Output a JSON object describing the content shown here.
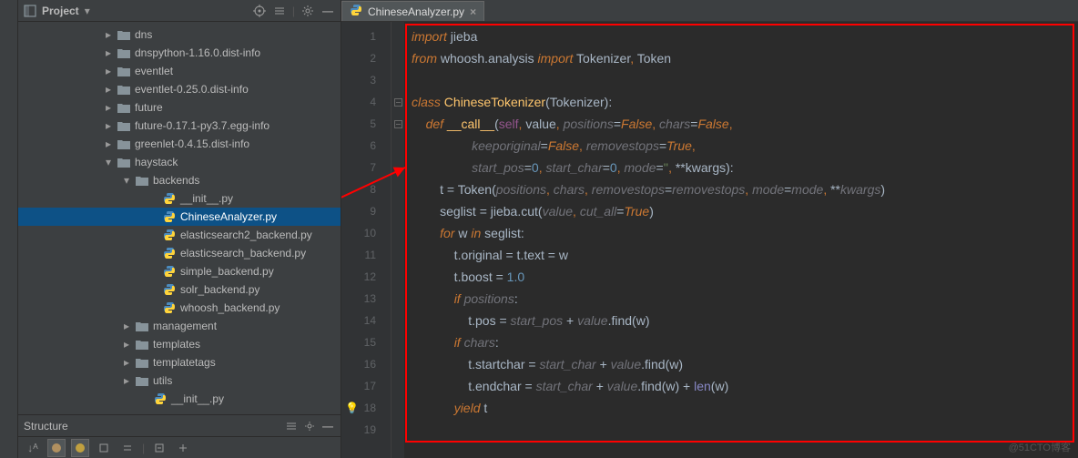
{
  "sidebar": {
    "title": "Project",
    "structure_title": "Structure",
    "tree": [
      {
        "indent": 80,
        "expand": "right",
        "icon": "folder",
        "label": "dns"
      },
      {
        "indent": 80,
        "expand": "right",
        "icon": "folder",
        "label": "dnspython-1.16.0.dist-info"
      },
      {
        "indent": 80,
        "expand": "right",
        "icon": "folder",
        "label": "eventlet"
      },
      {
        "indent": 80,
        "expand": "right",
        "icon": "folder",
        "label": "eventlet-0.25.0.dist-info"
      },
      {
        "indent": 80,
        "expand": "right",
        "icon": "folder",
        "label": "future"
      },
      {
        "indent": 80,
        "expand": "right",
        "icon": "folder",
        "label": "future-0.17.1-py3.7.egg-info"
      },
      {
        "indent": 80,
        "expand": "right",
        "icon": "folder",
        "label": "greenlet-0.4.15.dist-info"
      },
      {
        "indent": 80,
        "expand": "down",
        "icon": "folder",
        "label": "haystack"
      },
      {
        "indent": 100,
        "expand": "down",
        "icon": "folder",
        "label": "backends"
      },
      {
        "indent": 130,
        "expand": "none",
        "icon": "py",
        "label": "__init__.py"
      },
      {
        "indent": 130,
        "expand": "none",
        "icon": "py",
        "label": "ChineseAnalyzer.py",
        "selected": true
      },
      {
        "indent": 130,
        "expand": "none",
        "icon": "py",
        "label": "elasticsearch2_backend.py"
      },
      {
        "indent": 130,
        "expand": "none",
        "icon": "py",
        "label": "elasticsearch_backend.py"
      },
      {
        "indent": 130,
        "expand": "none",
        "icon": "py",
        "label": "simple_backend.py"
      },
      {
        "indent": 130,
        "expand": "none",
        "icon": "py",
        "label": "solr_backend.py"
      },
      {
        "indent": 130,
        "expand": "none",
        "icon": "py",
        "label": "whoosh_backend.py"
      },
      {
        "indent": 100,
        "expand": "right",
        "icon": "folder",
        "label": "management"
      },
      {
        "indent": 100,
        "expand": "right",
        "icon": "folder",
        "label": "templates"
      },
      {
        "indent": 100,
        "expand": "right",
        "icon": "folder",
        "label": "templatetags"
      },
      {
        "indent": 100,
        "expand": "right",
        "icon": "folder",
        "label": "utils"
      },
      {
        "indent": 120,
        "expand": "none",
        "icon": "py",
        "label": "__init__.py"
      }
    ]
  },
  "editor": {
    "tab": "ChineseAnalyzer.py",
    "watermark": "@51CTO博客",
    "lines": [
      {
        "n": 1,
        "fold": "",
        "html": "<span class='kw'>import</span> jieba"
      },
      {
        "n": 2,
        "fold": "",
        "html": "<span class='kw'>from</span> whoosh.analysis <span class='kw'>import</span> Tokenizer<span class='kw2'>,</span> Token"
      },
      {
        "n": 3,
        "fold": "",
        "html": ""
      },
      {
        "n": 4,
        "fold": "-",
        "html": "<span class='kw'>class</span> <span class='cls'>ChineseTokenizer</span>(Tokenizer):"
      },
      {
        "n": 5,
        "fold": "-",
        "html": "    <span class='kw'>def</span> <span class='fn'>__call__</span>(<span class='self'>self</span><span class='kw2'>,</span> <span class='paramv'>value</span><span class='kw2'>,</span> <span class='param'>positions</span>=<span class='bool'>False</span><span class='kw2'>,</span> <span class='param'>chars</span>=<span class='bool'>False</span><span class='kw2'>,</span>"
      },
      {
        "n": 6,
        "fold": "",
        "html": "                 <span class='param'>keeporiginal</span>=<span class='bool'>False</span><span class='kw2'>,</span> <span class='param'>removestops</span>=<span class='bool'>True</span><span class='kw2'>,</span>"
      },
      {
        "n": 7,
        "fold": "",
        "html": "                 <span class='param'>start_pos</span>=<span class='num'>0</span><span class='kw2'>,</span> <span class='param'>start_char</span>=<span class='num'>0</span><span class='kw2'>,</span> <span class='param'>mode</span>=<span class='str'>''</span><span class='kw2'>,</span> **kwargs):"
      },
      {
        "n": 8,
        "fold": "",
        "html": "        t = Token(<span class='param'>positions</span><span class='kw2'>,</span> <span class='param'>chars</span><span class='kw2'>,</span> <span class='param'>removestops</span>=<span class='param'>removestops</span><span class='kw2'>,</span> <span class='param'>mode</span>=<span class='param'>mode</span><span class='kw2'>,</span> **<span class='param'>kwargs</span>)"
      },
      {
        "n": 9,
        "fold": "",
        "html": "        seglist = jieba.cut(<span class='param'>value</span><span class='kw2'>,</span> <span class='param'>cut_all</span>=<span class='bool'>True</span>)"
      },
      {
        "n": 10,
        "fold": "",
        "html": "        <span class='kw'>for</span> w <span class='kw'>in</span> seglist:"
      },
      {
        "n": 11,
        "fold": "",
        "html": "            t.original = t.text = w"
      },
      {
        "n": 12,
        "fold": "",
        "html": "            t.boost = <span class='num'>1.0</span>"
      },
      {
        "n": 13,
        "fold": "",
        "html": "            <span class='kw'>if</span> <span class='param'>positions</span>:"
      },
      {
        "n": 14,
        "fold": "",
        "html": "                t.pos = <span class='param'>start_pos</span> + <span class='param'>value</span>.find(w)"
      },
      {
        "n": 15,
        "fold": "",
        "html": "            <span class='kw'>if</span> <span class='param'>chars</span>:"
      },
      {
        "n": 16,
        "fold": "",
        "html": "                t.startchar = <span class='param'>start_char</span> + <span class='param'>value</span>.find(w)"
      },
      {
        "n": 17,
        "fold": "",
        "html": "                t.endchar = <span class='param'>start_char</span> + <span class='param'>value</span>.find(w) + <span class='bi'>len</span>(w)"
      },
      {
        "n": 18,
        "fold": "",
        "bulb": true,
        "html": "            <span class='kw'>yield</span> t"
      },
      {
        "n": 19,
        "fold": "",
        "html": ""
      }
    ]
  }
}
